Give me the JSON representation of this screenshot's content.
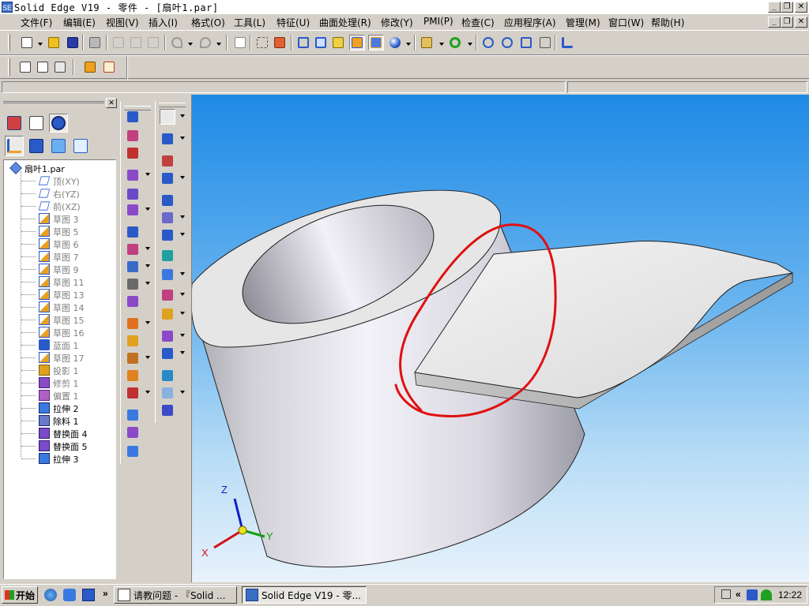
{
  "window": {
    "title": "Solid Edge V19 - 零件 - [扇叶1.par]",
    "app_icon": "SE",
    "minimize_glyph": "_",
    "restore_glyph": "❐",
    "close_glyph": "✕"
  },
  "menu": {
    "items": [
      {
        "label": "文件(F)"
      },
      {
        "label": "编辑(E)"
      },
      {
        "label": "视图(V)"
      },
      {
        "label": "插入(I)"
      },
      {
        "label": "格式(O)"
      },
      {
        "label": "工具(L)"
      },
      {
        "label": "特征(U)"
      },
      {
        "label": "曲面处理(R)"
      },
      {
        "label": "修改(Y)"
      },
      {
        "label": "PMI(P)"
      },
      {
        "label": "检查(C)"
      },
      {
        "label": "应用程序(A)"
      },
      {
        "label": "管理(M)"
      },
      {
        "label": "窗口(W)"
      },
      {
        "label": "帮助(H)"
      }
    ]
  },
  "edgebar": {
    "close_glyph": "✕",
    "tree_root": "扇叶1.par",
    "tree_items": [
      {
        "label": "顶(XY)",
        "icon": "plane-icon",
        "dim": true
      },
      {
        "label": "右(YZ)",
        "icon": "plane-icon",
        "dim": true
      },
      {
        "label": "前(XZ)",
        "icon": "plane-icon",
        "dim": true
      },
      {
        "label": "草图 3",
        "icon": "sketch-icon",
        "dim": true
      },
      {
        "label": "草图 5",
        "icon": "sketch-icon",
        "dim": true
      },
      {
        "label": "草图 6",
        "icon": "sketch-icon",
        "dim": true
      },
      {
        "label": "草图 7",
        "icon": "sketch-icon",
        "dim": true
      },
      {
        "label": "草图 9",
        "icon": "sketch-icon",
        "dim": true
      },
      {
        "label": "草图 11",
        "icon": "sketch-icon",
        "dim": true
      },
      {
        "label": "草图 13",
        "icon": "sketch-icon",
        "dim": true
      },
      {
        "label": "草图 14",
        "icon": "sketch-icon",
        "dim": true
      },
      {
        "label": "草图 15",
        "icon": "sketch-icon",
        "dim": true
      },
      {
        "label": "草图 16",
        "icon": "sketch-icon",
        "dim": true
      },
      {
        "label": "蓝面 1",
        "icon": "bluesurf-icon",
        "dim": true
      },
      {
        "label": "草图 17",
        "icon": "sketch-icon",
        "dim": true
      },
      {
        "label": "投影 1",
        "icon": "project-icon",
        "dim": true
      },
      {
        "label": "修剪 1",
        "icon": "trim-icon",
        "dim": true
      },
      {
        "label": "偏置 1",
        "icon": "offset-icon",
        "dim": true
      },
      {
        "label": "拉伸 2",
        "icon": "extrude-icon",
        "dim": false
      },
      {
        "label": "除料 1",
        "icon": "cutout-icon",
        "dim": false
      },
      {
        "label": "替换面 4",
        "icon": "replace-face-icon",
        "dim": false
      },
      {
        "label": "替换面 5",
        "icon": "replace-face-icon",
        "dim": false
      },
      {
        "label": "拉伸 3",
        "icon": "extrude-icon",
        "dim": false
      }
    ]
  },
  "viewport": {
    "triad": {
      "x_label": "X",
      "y_label": "Y",
      "z_label": "Z"
    }
  },
  "colors": {
    "viewport_top": "#1e8ae6",
    "viewport_bottom": "#e8f2fb",
    "annotation_red": "#e01010",
    "triad_x": "#d01010",
    "triad_y": "#10a010",
    "triad_z": "#1020c0"
  },
  "taskbar": {
    "start_label": "开始",
    "tasks": [
      {
        "label": "请教问题 - 『Solid ...",
        "active": false
      },
      {
        "label": "Solid Edge V19 - 零...",
        "active": true
      }
    ],
    "quicklaunch_more": "»",
    "tray_more": "«",
    "clock": "12:22"
  }
}
